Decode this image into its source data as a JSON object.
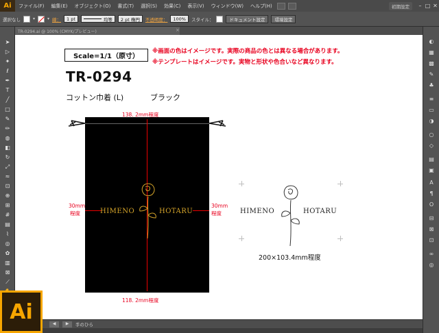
{
  "app": {
    "logo": "Ai",
    "menu": [
      "ファイル(F)",
      "編集(E)",
      "オブジェクト(O)",
      "書式(T)",
      "選択(S)",
      "効果(C)",
      "表示(V)",
      "ウィンドウ(W)",
      "ヘルプ(H)"
    ],
    "workspace": "初期設定"
  },
  "controlbar": {
    "selection": "選択なし",
    "stroke_label": "線：",
    "stroke_value": "1 pt",
    "stroke_profile": "均等",
    "brush": "2 pt 楕円",
    "opacity_label": "不透明度：",
    "opacity_value": "100%",
    "style_label": "スタイル：",
    "doc_setup": "ドキュメント設定",
    "prefs": "環境設定"
  },
  "doctab": {
    "title": "TR-0294.ai @ 100% (CMYK/プレビュー)"
  },
  "artwork": {
    "scale": "Scale=1/1（原寸）",
    "note1": "※画面の色はイメージです。実際の商品の色とは異なる場合があります。",
    "note2": "※テンプレートはイメージです。実物と形状や色合いなど異なります。",
    "code": "TR-0294",
    "name": "コットン巾着 (L)",
    "color": "ブラック",
    "dim_top": "138. 2mm程度",
    "dim_bottom": "118. 2mm程度",
    "dim_left_a": "30mm",
    "dim_left_b": "程度",
    "dim_right_a": "30mm",
    "dim_right_b": "程度",
    "logo_left": "HIMENO",
    "logo_right": "HOTARU",
    "logo_size": "200×103.4mm程度"
  },
  "status": {
    "tool": "手のひら"
  },
  "colors": {
    "accent": "#f7a600",
    "note_red": "#e8001e",
    "gold": "#d6a52a",
    "bag": "#000000"
  }
}
